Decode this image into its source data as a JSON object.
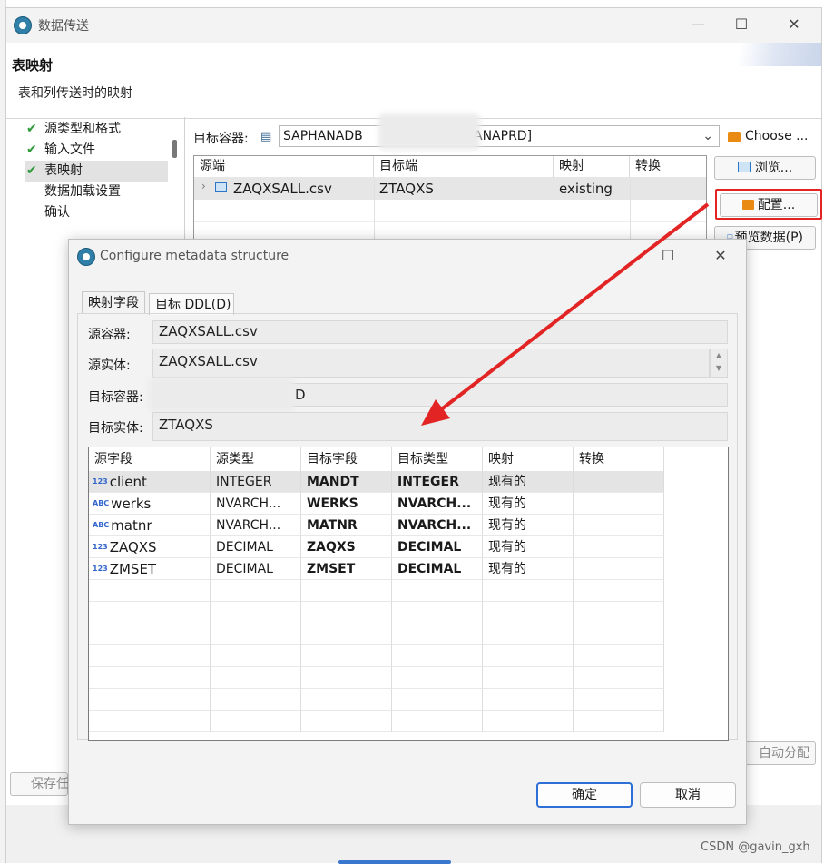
{
  "outer": {
    "title": "数据传送",
    "page_title": "表映射",
    "page_subtitle": "表和列传送时的映射",
    "steps": [
      {
        "label": "源类型和格式",
        "done": true
      },
      {
        "label": "输入文件",
        "done": true
      },
      {
        "label": "表映射",
        "done": true,
        "selected": true
      },
      {
        "label": "数据加载设置",
        "done": false
      },
      {
        "label": "确认",
        "done": false
      }
    ],
    "target_container_label": "目标容器:",
    "target_container_value_left": "SAPHANADB",
    "target_container_value_right": "ANAPRD]",
    "choose_button": "Choose ...",
    "browse_button": "浏览...",
    "configure_button": "配置...",
    "preview_button": "预览数据(P)",
    "auto_assign_button": "自动分配",
    "save_button": "保存任",
    "mapping_table": {
      "headers": [
        "源端",
        "目标端",
        "映射",
        "转换"
      ],
      "rows": [
        {
          "source": "ZAQXSALL.csv",
          "target": "ZTAQXS",
          "mapping": "existing",
          "transform": ""
        }
      ]
    }
  },
  "dialog": {
    "title": "Configure metadata structure",
    "tabs": [
      "映射字段",
      "目标 DDL(D)"
    ],
    "source_container_label": "源容器:",
    "source_container_value": "ZAQXSALL.csv",
    "source_entity_label": "源实体:",
    "source_entity_value": "ZAQXSALL.csv",
    "target_container_label": "目标容器:",
    "target_container_value_suffix": "D",
    "target_entity_label": "目标实体:",
    "target_entity_value": "ZTAQXS",
    "columns": [
      "源字段",
      "源类型",
      "目标字段",
      "目标类型",
      "映射",
      "转换"
    ],
    "rows": [
      {
        "type_tag": "123",
        "source_field": "client",
        "source_type": "INTEGER",
        "target_field": "MANDT",
        "target_type": "INTEGER",
        "mapping": "现有的",
        "transform": ""
      },
      {
        "type_tag": "ABC",
        "source_field": "werks",
        "source_type": "NVARCH...",
        "target_field": "WERKS",
        "target_type": "NVARCH...",
        "mapping": "现有的",
        "transform": ""
      },
      {
        "type_tag": "ABC",
        "source_field": "matnr",
        "source_type": "NVARCH...",
        "target_field": "MATNR",
        "target_type": "NVARCH...",
        "mapping": "现有的",
        "transform": ""
      },
      {
        "type_tag": "123",
        "source_field": "ZAQXS",
        "source_type": "DECIMAL",
        "target_field": "ZAQXS",
        "target_type": "DECIMAL",
        "mapping": "现有的",
        "transform": ""
      },
      {
        "type_tag": "123",
        "source_field": "ZMSET",
        "source_type": "DECIMAL",
        "target_field": "ZMSET",
        "target_type": "DECIMAL",
        "mapping": "现有的",
        "transform": ""
      }
    ],
    "ok_button": "确定",
    "cancel_button": "取消"
  },
  "watermark": "CSDN @gavin_gxh",
  "colors": {
    "annotation_red": "#e22424",
    "check_green": "#2e9a3a",
    "ok_border": "#2d6fd6"
  }
}
